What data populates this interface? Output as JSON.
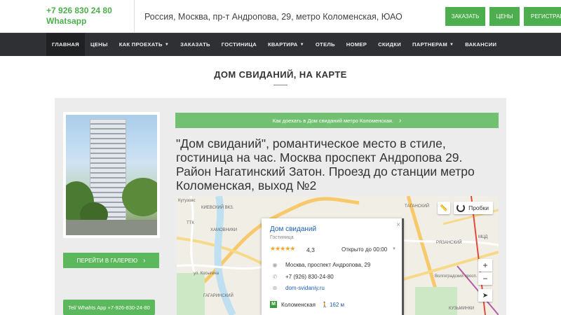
{
  "header": {
    "phone": "+7 926 830 24 80",
    "whatsapp": "Whatsapp",
    "address": "Россия, Москва, пр-т Андропова, 29, метро Коломенская, ЮАО",
    "buttons": [
      "ЗАКАЗАТЬ",
      "ЦЕНЫ",
      "РЕГИСТРАЦ"
    ]
  },
  "nav": [
    {
      "label": "ГЛАВНАЯ",
      "caret": false,
      "active": true
    },
    {
      "label": "ЦЕНЫ",
      "caret": false
    },
    {
      "label": "КАК ПРОЕХАТЬ",
      "caret": true
    },
    {
      "label": "ЗАКАЗАТЬ",
      "caret": false
    },
    {
      "label": "ГОСТИНИЦА",
      "caret": false
    },
    {
      "label": "КВАРТИРА",
      "caret": true
    },
    {
      "label": "ОТЕЛЬ",
      "caret": false
    },
    {
      "label": "НОМЕР",
      "caret": false
    },
    {
      "label": "СКИДКИ",
      "caret": false
    },
    {
      "label": "ПАРТНЕРАМ",
      "caret": true
    },
    {
      "label": "ВАКАНСИИ",
      "caret": false
    }
  ],
  "page": {
    "title": "ДОМ СВИДАНИЙ, НА КАРТЕ",
    "gallery_button": "ПЕРЕЙТИ В ГАЛЕРЕЮ",
    "whatsapp_button": "Tel/ Whahts App +7-926-830-24-80",
    "howto_button": "Как доехать в Дом свиданий метро Коломенская.",
    "description": "\"Дом свиданий\", романтическое место в стиле, гостиница на час. Москва проспект Андропова 29. Район Нагатинский Затон. Проезд до станции метро Коломенская, выход №2"
  },
  "map": {
    "probki": "Пробки",
    "zoom_in": "+",
    "zoom_out": "−",
    "labels": [
      "Киевский вкз.",
      "ТАГАНСКИЙ",
      "ХАМОВНИКИ",
      "ГАГАРИНСКИЙ",
      "РЯЗАНСКИЙ",
      "КУЗЬМИНКИ",
      "Кутузовс",
      "ТТК",
      "ул. Косыгина",
      "Волгоградский просп.",
      "МЦД"
    ],
    "card": {
      "name": "Дом свиданий",
      "category": "Гостиница",
      "stars": "★★★★★",
      "rating": "4,3",
      "hours": "Открыто до 00:00",
      "address": "Москва, проспект Андропова, 29",
      "phone": "+7 (926) 830-24-80",
      "site": "dom-svidaniy.ru",
      "metro": "Коломенская",
      "metro_letter": "М",
      "metro_distance": "162 м",
      "close": "×"
    }
  },
  "colors": {
    "green": "#5cb85c",
    "nav_bg": "#2e3033",
    "link": "#1f5fb3"
  }
}
